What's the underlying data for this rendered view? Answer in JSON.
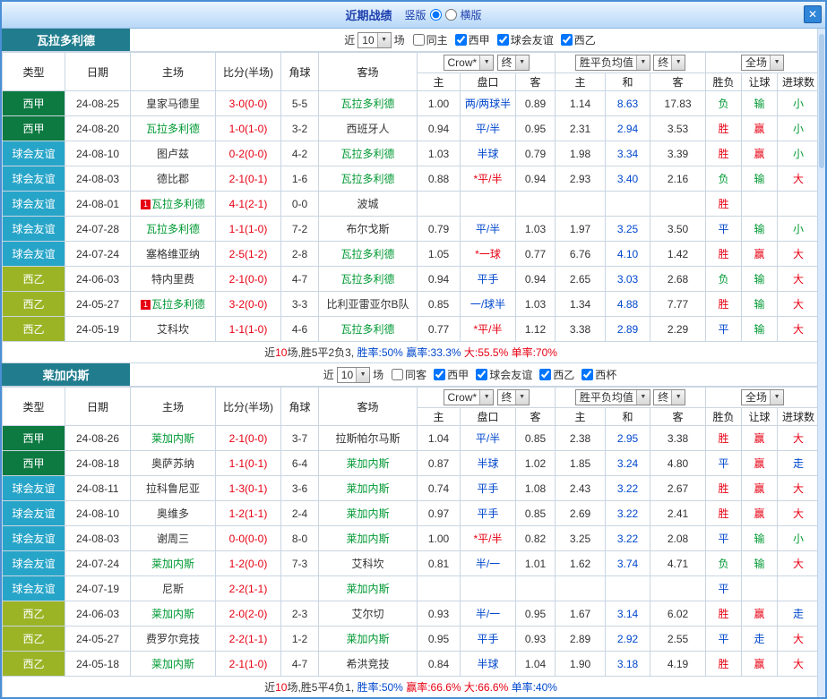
{
  "titlebar": {
    "title": "近期战绩",
    "options": [
      {
        "label": "竖版",
        "selected": true
      },
      {
        "label": "横版",
        "selected": false
      }
    ],
    "close_icon": "✕"
  },
  "colors": {
    "liga_bg": "#0d7a41",
    "friendly_bg": "#27a5c9",
    "segunda_bg": "#9bb426",
    "team_header_teal": "#217d8e",
    "team_name_green": "#009933",
    "score_red": "#e60012",
    "draw_blue": "#0047cc",
    "titlebar_blue": "#b7d8f7"
  },
  "table": {
    "left_headers": [
      "类型",
      "日期",
      "主场",
      "比分(半场)",
      "角球",
      "客场"
    ],
    "sub_headers": [
      "主",
      "盘口",
      "客",
      "主",
      "和",
      "客",
      "胜负",
      "让球",
      "进球数"
    ]
  },
  "controls": {
    "near": "近",
    "count": "10",
    "matches": "场",
    "odds_source": "Crow*",
    "final1": "终",
    "avg_label": "胜平负均值",
    "final2": "终",
    "scope": "全场"
  },
  "sections": [
    {
      "team": "瓦拉多利德",
      "checkboxes": [
        {
          "label": "同主",
          "checked": false
        },
        {
          "label": "西甲",
          "checked": true
        },
        {
          "label": "球会友谊",
          "checked": true
        },
        {
          "label": "西乙",
          "checked": true
        }
      ],
      "rows": [
        {
          "league": "西甲",
          "league_class": "liga",
          "date": "24-08-25",
          "home": "皇家马德里",
          "home_team": false,
          "home_badge": "",
          "score": "3-0(0-0)",
          "corners": "5-5",
          "away": "瓦拉多利德",
          "away_team": true,
          "odds": [
            "1.00",
            "两/两球半",
            "0.89"
          ],
          "handicap_red": false,
          "avg": [
            "1.14",
            "8.63",
            "17.83"
          ],
          "results": [
            [
              "负",
              "green"
            ],
            [
              "输",
              "green"
            ],
            [
              "小",
              "green"
            ]
          ]
        },
        {
          "league": "西甲",
          "league_class": "liga",
          "date": "24-08-20",
          "home": "瓦拉多利德",
          "home_team": true,
          "home_badge": "",
          "score": "1-0(1-0)",
          "corners": "3-2",
          "away": "西班牙人",
          "away_team": false,
          "odds": [
            "0.94",
            "平/半",
            "0.95"
          ],
          "handicap_red": false,
          "avg": [
            "2.31",
            "2.94",
            "3.53"
          ],
          "results": [
            [
              "胜",
              "red"
            ],
            [
              "赢",
              "red"
            ],
            [
              "小",
              "green"
            ]
          ]
        },
        {
          "league": "球会友谊",
          "league_class": "friendly",
          "date": "24-08-10",
          "home": "图卢兹",
          "home_team": false,
          "home_badge": "",
          "score": "0-2(0-0)",
          "corners": "4-2",
          "away": "瓦拉多利德",
          "away_team": true,
          "odds": [
            "1.03",
            "半球",
            "0.79"
          ],
          "handicap_red": false,
          "avg": [
            "1.98",
            "3.34",
            "3.39"
          ],
          "results": [
            [
              "胜",
              "red"
            ],
            [
              "赢",
              "red"
            ],
            [
              "小",
              "green"
            ]
          ]
        },
        {
          "league": "球会友谊",
          "league_class": "friendly",
          "date": "24-08-03",
          "home": "德比郡",
          "home_team": false,
          "home_badge": "",
          "score": "2-1(0-1)",
          "corners": "1-6",
          "away": "瓦拉多利德",
          "away_team": true,
          "odds": [
            "0.88",
            "*平/半",
            "0.94"
          ],
          "handicap_red": true,
          "avg": [
            "2.93",
            "3.40",
            "2.16"
          ],
          "results": [
            [
              "负",
              "green"
            ],
            [
              "输",
              "green"
            ],
            [
              "大",
              "red"
            ]
          ]
        },
        {
          "league": "球会友谊",
          "league_class": "friendly",
          "date": "24-08-01",
          "home": "瓦拉多利德",
          "home_team": true,
          "home_badge": "1",
          "score": "4-1(2-1)",
          "corners": "0-0",
          "away": "波城",
          "away_team": false,
          "odds": [
            "",
            "",
            ""
          ],
          "handicap_red": false,
          "avg": [
            "",
            "",
            ""
          ],
          "results": [
            [
              "胜",
              "red"
            ],
            [
              "",
              ""
            ],
            [
              "",
              ""
            ]
          ]
        },
        {
          "league": "球会友谊",
          "league_class": "friendly",
          "date": "24-07-28",
          "home": "瓦拉多利德",
          "home_team": true,
          "home_badge": "",
          "score": "1-1(1-0)",
          "corners": "7-2",
          "away": "布尔戈斯",
          "away_team": false,
          "odds": [
            "0.79",
            "平/半",
            "1.03"
          ],
          "handicap_red": false,
          "avg": [
            "1.97",
            "3.25",
            "3.50"
          ],
          "results": [
            [
              "平",
              "blue"
            ],
            [
              "输",
              "green"
            ],
            [
              "小",
              "green"
            ]
          ]
        },
        {
          "league": "球会友谊",
          "league_class": "friendly",
          "date": "24-07-24",
          "home": "塞格维亚纳",
          "home_team": false,
          "home_badge": "",
          "score": "2-5(1-2)",
          "corners": "2-8",
          "away": "瓦拉多利德",
          "away_team": true,
          "odds": [
            "1.05",
            "*一球",
            "0.77"
          ],
          "handicap_red": true,
          "avg": [
            "6.76",
            "4.10",
            "1.42"
          ],
          "results": [
            [
              "胜",
              "red"
            ],
            [
              "赢",
              "red"
            ],
            [
              "大",
              "red"
            ]
          ]
        },
        {
          "league": "西乙",
          "league_class": "segunda",
          "date": "24-06-03",
          "home": "特内里费",
          "home_team": false,
          "home_badge": "",
          "score": "2-1(0-0)",
          "corners": "4-7",
          "away": "瓦拉多利德",
          "away_team": true,
          "odds": [
            "0.94",
            "平手",
            "0.94"
          ],
          "handicap_red": false,
          "avg": [
            "2.65",
            "3.03",
            "2.68"
          ],
          "results": [
            [
              "负",
              "green"
            ],
            [
              "输",
              "green"
            ],
            [
              "大",
              "red"
            ]
          ]
        },
        {
          "league": "西乙",
          "league_class": "segunda",
          "date": "24-05-27",
          "home": "瓦拉多利德",
          "home_team": true,
          "home_badge": "1",
          "score": "3-2(0-0)",
          "corners": "3-3",
          "away": "比利亚雷亚尔B队",
          "away_team": false,
          "odds": [
            "0.85",
            "一/球半",
            "1.03"
          ],
          "handicap_red": false,
          "avg": [
            "1.34",
            "4.88",
            "7.77"
          ],
          "results": [
            [
              "胜",
              "red"
            ],
            [
              "输",
              "green"
            ],
            [
              "大",
              "red"
            ]
          ]
        },
        {
          "league": "西乙",
          "league_class": "segunda",
          "date": "24-05-19",
          "home": "艾科坎",
          "home_team": false,
          "home_badge": "",
          "score": "1-1(1-0)",
          "corners": "4-6",
          "away": "瓦拉多利德",
          "away_team": true,
          "odds": [
            "0.77",
            "*平/半",
            "1.12"
          ],
          "handicap_red": true,
          "avg": [
            "3.38",
            "2.89",
            "2.29"
          ],
          "results": [
            [
              "平",
              "blue"
            ],
            [
              "输",
              "green"
            ],
            [
              "大",
              "red"
            ]
          ]
        }
      ],
      "summary": [
        {
          "text": "近",
          "color": "black"
        },
        {
          "text": "10",
          "color": "red"
        },
        {
          "text": "场,胜5平2负3, ",
          "color": "black"
        },
        {
          "text": "胜率:50%",
          "color": "blue"
        },
        {
          "text": " 赢率:33.3%",
          "color": "blue"
        },
        {
          "text": " 大:55.5%",
          "color": "red"
        },
        {
          "text": " 单率:70%",
          "color": "red"
        }
      ]
    },
    {
      "team": "莱加内斯",
      "checkboxes": [
        {
          "label": "同客",
          "checked": false
        },
        {
          "label": "西甲",
          "checked": true
        },
        {
          "label": "球会友谊",
          "checked": true
        },
        {
          "label": "西乙",
          "checked": true
        },
        {
          "label": "西杯",
          "checked": true
        }
      ],
      "rows": [
        {
          "league": "西甲",
          "league_class": "liga",
          "date": "24-08-26",
          "home": "莱加内斯",
          "home_team": true,
          "home_badge": "",
          "score": "2-1(0-0)",
          "corners": "3-7",
          "away": "拉斯帕尔马斯",
          "away_team": false,
          "odds": [
            "1.04",
            "平/半",
            "0.85"
          ],
          "handicap_red": false,
          "avg": [
            "2.38",
            "2.95",
            "3.38"
          ],
          "results": [
            [
              "胜",
              "red"
            ],
            [
              "赢",
              "red"
            ],
            [
              "大",
              "red"
            ]
          ]
        },
        {
          "league": "西甲",
          "league_class": "liga",
          "date": "24-08-18",
          "home": "奥萨苏纳",
          "home_team": false,
          "home_badge": "",
          "score": "1-1(0-1)",
          "corners": "6-4",
          "away": "莱加内斯",
          "away_team": true,
          "odds": [
            "0.87",
            "半球",
            "1.02"
          ],
          "handicap_red": false,
          "avg": [
            "1.85",
            "3.24",
            "4.80"
          ],
          "results": [
            [
              "平",
              "blue"
            ],
            [
              "赢",
              "red"
            ],
            [
              "走",
              "blue"
            ]
          ]
        },
        {
          "league": "球会友谊",
          "league_class": "friendly",
          "date": "24-08-11",
          "home": "拉科鲁尼亚",
          "home_team": false,
          "home_badge": "",
          "score": "1-3(0-1)",
          "corners": "3-6",
          "away": "莱加内斯",
          "away_team": true,
          "odds": [
            "0.74",
            "平手",
            "1.08"
          ],
          "handicap_red": false,
          "avg": [
            "2.43",
            "3.22",
            "2.67"
          ],
          "results": [
            [
              "胜",
              "red"
            ],
            [
              "赢",
              "red"
            ],
            [
              "大",
              "red"
            ]
          ]
        },
        {
          "league": "球会友谊",
          "league_class": "friendly",
          "date": "24-08-10",
          "home": "奥维多",
          "home_team": false,
          "home_badge": "",
          "score": "1-2(1-1)",
          "corners": "2-4",
          "away": "莱加内斯",
          "away_team": true,
          "odds": [
            "0.97",
            "平手",
            "0.85"
          ],
          "handicap_red": false,
          "avg": [
            "2.69",
            "3.22",
            "2.41"
          ],
          "results": [
            [
              "胜",
              "red"
            ],
            [
              "赢",
              "red"
            ],
            [
              "大",
              "red"
            ]
          ]
        },
        {
          "league": "球会友谊",
          "league_class": "friendly",
          "date": "24-08-03",
          "home": "谢周三",
          "home_team": false,
          "home_badge": "",
          "score": "0-0(0-0)",
          "corners": "8-0",
          "away": "莱加内斯",
          "away_team": true,
          "odds": [
            "1.00",
            "*平/半",
            "0.82"
          ],
          "handicap_red": true,
          "avg": [
            "3.25",
            "3.22",
            "2.08"
          ],
          "results": [
            [
              "平",
              "blue"
            ],
            [
              "输",
              "green"
            ],
            [
              "小",
              "green"
            ]
          ]
        },
        {
          "league": "球会友谊",
          "league_class": "friendly",
          "date": "24-07-24",
          "home": "莱加内斯",
          "home_team": true,
          "home_badge": "",
          "score": "1-2(0-0)",
          "corners": "7-3",
          "away": "艾科坎",
          "away_team": false,
          "odds": [
            "0.81",
            "半/一",
            "1.01"
          ],
          "handicap_red": false,
          "avg": [
            "1.62",
            "3.74",
            "4.71"
          ],
          "results": [
            [
              "负",
              "green"
            ],
            [
              "输",
              "green"
            ],
            [
              "大",
              "red"
            ]
          ]
        },
        {
          "league": "球会友谊",
          "league_class": "friendly",
          "date": "24-07-19",
          "home": "尼斯",
          "home_team": false,
          "home_badge": "",
          "score": "2-2(1-1)",
          "corners": "",
          "away": "莱加内斯",
          "away_team": true,
          "odds": [
            "",
            "",
            ""
          ],
          "handicap_red": false,
          "avg": [
            "",
            "",
            ""
          ],
          "results": [
            [
              "平",
              "blue"
            ],
            [
              "",
              ""
            ],
            [
              "",
              ""
            ]
          ]
        },
        {
          "league": "西乙",
          "league_class": "segunda",
          "date": "24-06-03",
          "home": "莱加内斯",
          "home_team": true,
          "home_badge": "",
          "score": "2-0(2-0)",
          "corners": "2-3",
          "away": "艾尔切",
          "away_team": false,
          "odds": [
            "0.93",
            "半/一",
            "0.95"
          ],
          "handicap_red": false,
          "avg": [
            "1.67",
            "3.14",
            "6.02"
          ],
          "results": [
            [
              "胜",
              "red"
            ],
            [
              "赢",
              "red"
            ],
            [
              "走",
              "blue"
            ]
          ]
        },
        {
          "league": "西乙",
          "league_class": "segunda",
          "date": "24-05-27",
          "home": "费罗尔竞技",
          "home_team": false,
          "home_badge": "",
          "score": "2-2(1-1)",
          "corners": "1-2",
          "away": "莱加内斯",
          "away_team": true,
          "odds": [
            "0.95",
            "平手",
            "0.93"
          ],
          "handicap_red": false,
          "avg": [
            "2.89",
            "2.92",
            "2.55"
          ],
          "results": [
            [
              "平",
              "blue"
            ],
            [
              "走",
              "blue"
            ],
            [
              "大",
              "red"
            ]
          ]
        },
        {
          "league": "西乙",
          "league_class": "segunda",
          "date": "24-05-18",
          "home": "莱加内斯",
          "home_team": true,
          "home_badge": "",
          "score": "2-1(1-0)",
          "corners": "4-7",
          "away": "希洪竞技",
          "away_team": false,
          "odds": [
            "0.84",
            "半球",
            "1.04"
          ],
          "handicap_red": false,
          "avg": [
            "1.90",
            "3.18",
            "4.19"
          ],
          "results": [
            [
              "胜",
              "red"
            ],
            [
              "赢",
              "red"
            ],
            [
              "大",
              "red"
            ]
          ]
        }
      ],
      "summary": [
        {
          "text": "近",
          "color": "black"
        },
        {
          "text": "10",
          "color": "red"
        },
        {
          "text": "场,胜5平4负1, ",
          "color": "black"
        },
        {
          "text": "胜率:50%",
          "color": "blue"
        },
        {
          "text": " 赢率:66.6%",
          "color": "red"
        },
        {
          "text": " 大:66.6%",
          "color": "red"
        },
        {
          "text": " 单率:40%",
          "color": "blue"
        }
      ]
    }
  ]
}
